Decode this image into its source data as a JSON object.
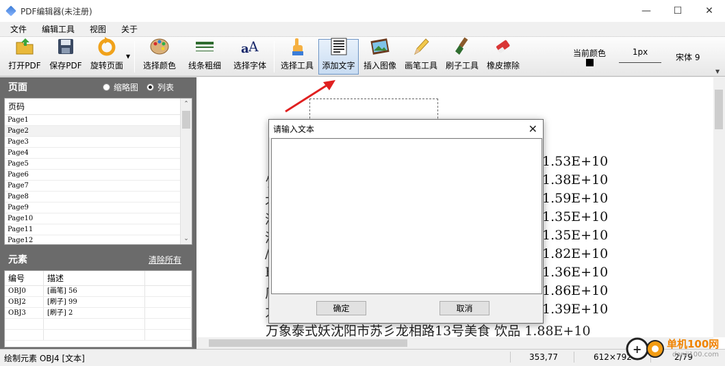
{
  "window": {
    "title": "PDF编辑器(未注册)"
  },
  "menu": [
    "文件",
    "编辑工具",
    "视图",
    "关于"
  ],
  "toolbar": {
    "open": "打开PDF",
    "save": "保存PDF",
    "rotate": "旋转页面",
    "pick_color": "选择颜色",
    "line_width": "线条粗细",
    "pick_font": "选择字体",
    "select_tool": "选择工具",
    "add_text": "添加文字",
    "insert_image": "插入图像",
    "pen_tool": "画笔工具",
    "brush_tool": "刷子工具",
    "eraser": "橡皮擦除",
    "current_color_label": "当前颜色",
    "current_color": "#000000",
    "line_width_value": "1px",
    "font_value": "宋体 9"
  },
  "pages_panel": {
    "title": "页面",
    "view_thumb": "缩略图",
    "view_list": "列表",
    "selected_view": "列表",
    "column": "页码",
    "pages": [
      "Page1",
      "Page2",
      "Page3",
      "Page4",
      "Page5",
      "Page6",
      "Page7",
      "Page8",
      "Page9",
      "Page10",
      "Page11",
      "Page12"
    ],
    "selected": "Page2"
  },
  "elements_panel": {
    "title": "元素",
    "clear_all": "清除所有",
    "columns": [
      "编号",
      "描述"
    ],
    "rows": [
      {
        "id": "OBJ0",
        "desc": "[画笔] 56"
      },
      {
        "id": "OBJ2",
        "desc": "[刷子] 99"
      },
      {
        "id": "OBJ3",
        "desc": "[刷子] 2"
      }
    ]
  },
  "document": {
    "values": [
      "1.53E+10",
      "1.38E+10",
      "1.59E+10",
      "1.35E+10",
      "1.35E+10",
      "1.82E+10",
      "1.36E+10",
      "1.86E+10",
      "1.39E+10"
    ],
    "fragments": [
      "",
      "饣",
      "才",
      "汇",
      "沪",
      "/",
      "F",
      "厂",
      "力"
    ],
    "bottom_line": "万象泰式妖沈阳市苏彡龙相路13号美食 饮品 1.88E+10"
  },
  "dialog": {
    "title": "请输入文本",
    "text": "",
    "ok": "确定",
    "cancel": "取消"
  },
  "status": {
    "left": "绘制元素 OBJ4 [文本]",
    "coords": "353,77",
    "size": "612×792",
    "page": "2/79"
  },
  "watermark": {
    "text": "单机100网",
    "url": "danji100.com"
  }
}
